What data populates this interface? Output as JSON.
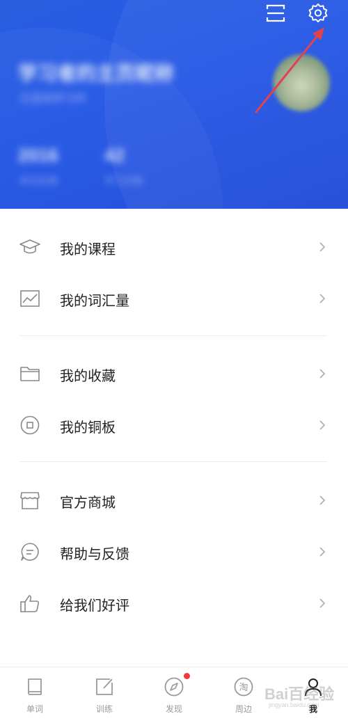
{
  "header": {
    "username": "学习者的主页昵称",
    "subtitle": "已坚持学习中",
    "stats": [
      {
        "value": "2016",
        "label": "单词总数"
      },
      {
        "value": "42",
        "label": "学习天数"
      }
    ],
    "accent_color": "#2457e6",
    "annotation_arrow_color": "#e0424f"
  },
  "menu": {
    "group1": [
      {
        "label": "我的课程",
        "icon": "graduation-cap-icon"
      },
      {
        "label": "我的词汇量",
        "icon": "chart-trend-icon"
      }
    ],
    "group2": [
      {
        "label": "我的收藏",
        "icon": "folder-icon"
      },
      {
        "label": "我的铜板",
        "icon": "coin-icon"
      }
    ],
    "group3": [
      {
        "label": "官方商城",
        "icon": "shop-icon"
      },
      {
        "label": "帮助与反馈",
        "icon": "chat-bubble-icon"
      },
      {
        "label": "给我们好评",
        "icon": "thumbs-up-icon"
      }
    ]
  },
  "bottom_nav": {
    "items": [
      {
        "label": "单词",
        "icon": "book-icon",
        "active": false
      },
      {
        "label": "训练",
        "icon": "edit-icon",
        "active": false
      },
      {
        "label": "发现",
        "icon": "compass-icon",
        "active": false,
        "badge": true
      },
      {
        "label": "周边",
        "icon": "taobao-icon",
        "active": false
      },
      {
        "label": "我",
        "icon": "person-icon",
        "active": true
      }
    ],
    "badge_color": "#f03a3a"
  },
  "watermark": {
    "text": "Bai百经验",
    "sub": "jingyan.baidu.com"
  }
}
